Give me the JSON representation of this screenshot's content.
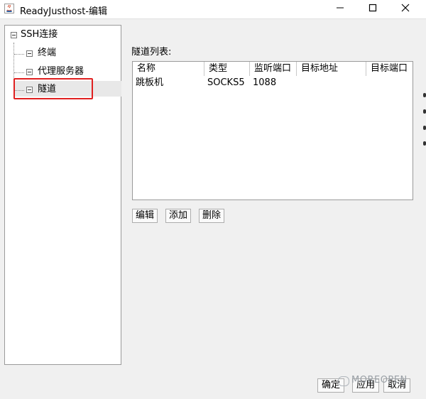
{
  "window": {
    "title": "ReadyJusthost-编辑",
    "minimize_icon": "minimize-icon",
    "maximize_icon": "maximize-icon",
    "close_icon": "close-icon"
  },
  "tree": {
    "root": "SSH连接",
    "children": [
      {
        "label": "终端"
      },
      {
        "label": "代理服务器"
      },
      {
        "label": "隧道"
      }
    ],
    "highlight_color": "#e02020"
  },
  "tunnels": {
    "title": "隧道列表:",
    "columns": [
      "名称",
      "类型",
      "监听端口",
      "目标地址",
      "目标端口"
    ],
    "rows": [
      {
        "name": "跳板机",
        "type": "SOCKS5",
        "listen_port": "1088",
        "target_addr": "",
        "target_port": ""
      }
    ]
  },
  "actions": {
    "edit": "编辑",
    "add": "添加",
    "delete": "删除"
  },
  "footer": {
    "ok": "确定",
    "apply": "应用",
    "cancel": "取消"
  },
  "watermark": "MOREOPEN"
}
